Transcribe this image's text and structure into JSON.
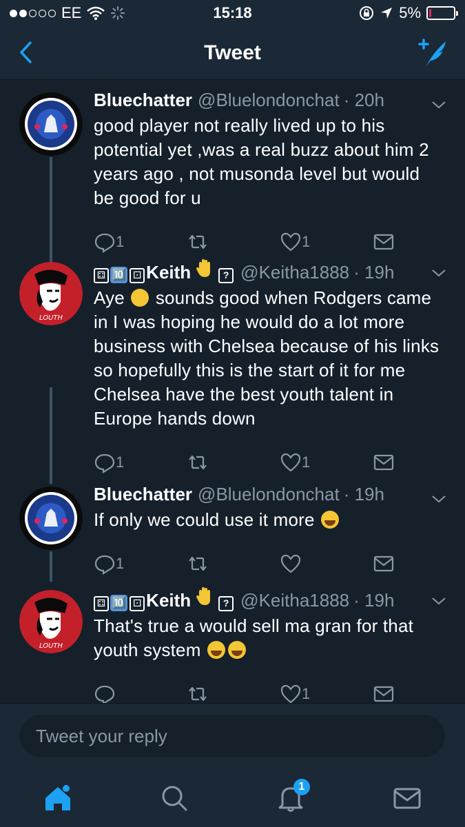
{
  "status_bar": {
    "carrier": "EE",
    "time": "15:18",
    "battery": "5%",
    "battery_level": 0.05,
    "battery_color": "#e0245e"
  },
  "nav": {
    "title": "Tweet",
    "back_icon": "chevron-left-icon",
    "compose_icon": "compose-tweet-icon"
  },
  "tweets": [
    {
      "name": "Bluechatter",
      "handle": "@Bluelondonchat",
      "time": "· 20h",
      "text": "good player not really lived up to his potential yet ,was a real buzz about him 2 years ago , not musonda level but would be good for u",
      "replies": "1",
      "retweets": "",
      "likes": "1"
    },
    {
      "name_prefix": "🔟",
      "name": "Keith",
      "name_suffix": "?",
      "handle": "@Keitha1888",
      "time": "· 19h",
      "text_before_emoji": "Aye",
      "text": "sounds good when Rodgers came in I was hoping he would do a lot more business with Chelsea because of his links so hopefully this is the start of it for me Chelsea have the best youth talent in Europe hands down",
      "replies": "1",
      "retweets": "",
      "likes": "1"
    },
    {
      "name": "Bluechatter",
      "handle": "@Bluelondonchat",
      "time": "· 19h",
      "text": "If only we could use it more",
      "replies": "1",
      "retweets": "",
      "likes": ""
    },
    {
      "name_prefix": "🔟",
      "name": "Keith",
      "name_suffix": "?",
      "handle": "@Keitha1888",
      "time": "· 19h",
      "text": "That's true a would sell ma gran for that youth system",
      "replies": "",
      "retweets": "",
      "likes": "1"
    }
  ],
  "reply": {
    "placeholder": "Tweet your reply"
  },
  "tabs": {
    "notifications_badge": "1",
    "accent": "#1da1f2"
  }
}
